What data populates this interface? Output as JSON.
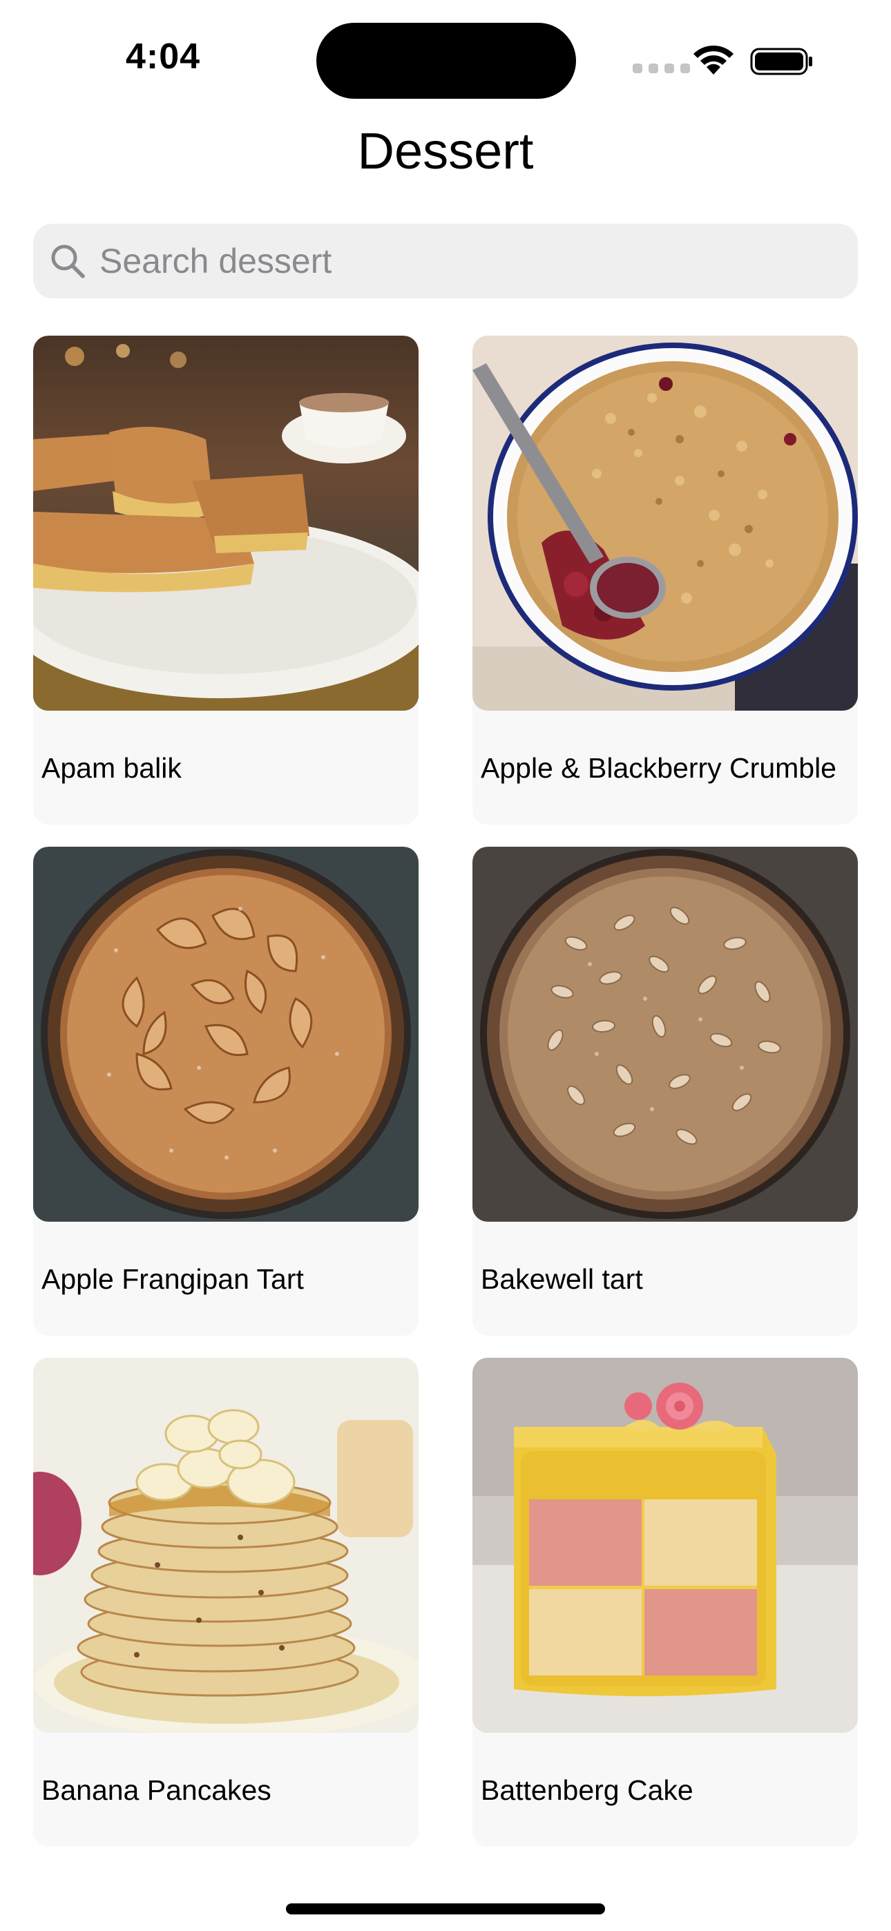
{
  "status_bar": {
    "time": "4:04",
    "icons": [
      "cellular-signal-icon",
      "wifi-icon",
      "battery-icon"
    ]
  },
  "nav": {
    "title": "Dessert"
  },
  "search": {
    "placeholder": "Search dessert",
    "value": "",
    "icon": "search-icon"
  },
  "desserts": [
    {
      "name": "Apam balik",
      "image": "apam-balik-photo"
    },
    {
      "name": "Apple & Blackberry Crumble",
      "image": "apple-blackberry-crumble-photo"
    },
    {
      "name": "Apple Frangipan Tart",
      "image": "apple-frangipan-tart-photo"
    },
    {
      "name": "Bakewell tart",
      "image": "bakewell-tart-photo"
    },
    {
      "name": "Banana Pancakes",
      "image": "banana-pancakes-photo"
    },
    {
      "name": "Battenberg Cake",
      "image": "battenberg-cake-photo"
    }
  ],
  "colors": {
    "background": "#ffffff",
    "search_field": "#efeff0",
    "card": "#f8f8f8",
    "placeholder": "#8a8a8e"
  }
}
